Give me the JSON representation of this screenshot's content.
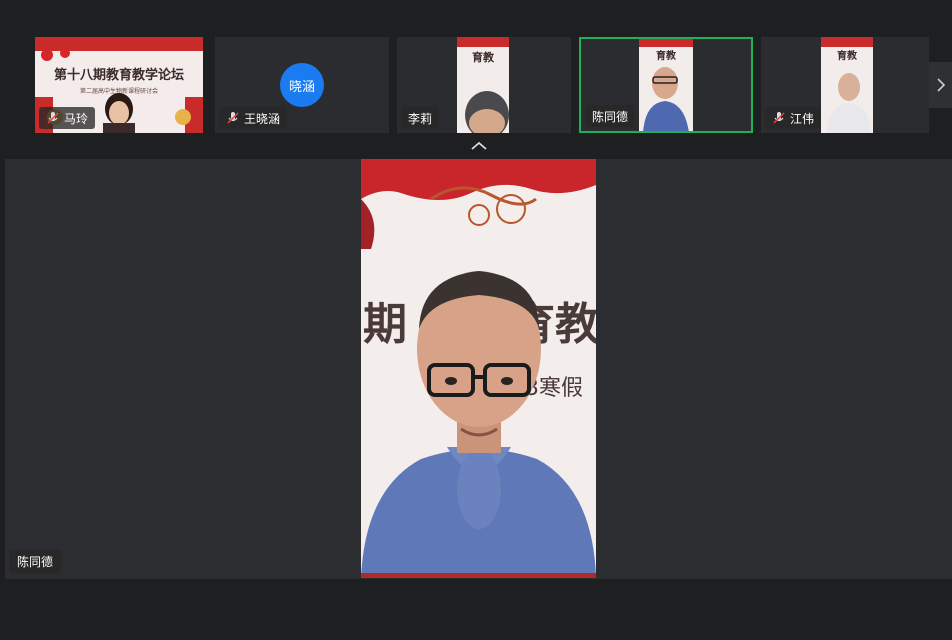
{
  "participants": [
    {
      "name": "马玲",
      "muted": true
    },
    {
      "name": "王晓涵",
      "muted": true,
      "avatar_text": "晓涵",
      "avatar_color": "#1a7cf0"
    },
    {
      "name": "李莉",
      "muted": false
    },
    {
      "name": "陈同德",
      "muted": false,
      "active": true
    },
    {
      "name": "江伟",
      "muted": true
    }
  ],
  "banner": {
    "line1": "第十八期教育教学论坛",
    "line2": "第二届高中生物新课程研讨会",
    "main_fragment1": "期",
    "main_fragment2": "育教",
    "main_sub": "23寒假"
  },
  "main_speaker": {
    "name": "陈同德"
  },
  "colors": {
    "active_border": "#1fb05a",
    "avatar_blue": "#1a7cf0"
  }
}
